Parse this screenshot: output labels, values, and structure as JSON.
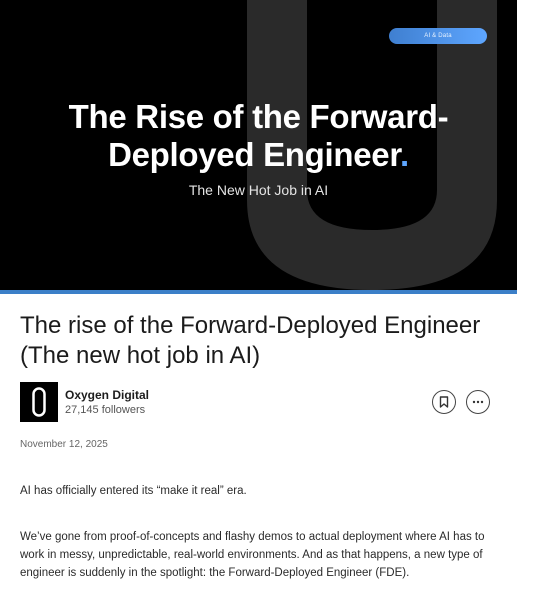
{
  "hero": {
    "badge": "AI & Data",
    "title_line1": "The Rise of the Forward-",
    "title_line2": "Deployed Engineer",
    "title_dot": ".",
    "subtitle": "The New Hot Job in AI",
    "colors": {
      "background": "#000000",
      "accent": "#5ea6ff",
      "bar": "#3b7fc8"
    }
  },
  "article": {
    "title": "The rise of the Forward-Deployed Engineer (The new hot job in AI)",
    "date": "November 12, 2025",
    "paragraphs": [
      "AI has officially entered its “make it real” era.",
      "We’ve gone from proof-of-concepts and flashy demos to actual deployment where AI has to work in messy, unpredictable, real-world environments. And as that happens, a new type of engineer is suddenly in the spotlight: the Forward-Deployed Engineer (FDE)."
    ]
  },
  "author": {
    "name": "Oxygen Digital",
    "followers": "27,145 followers",
    "avatar_icon": "oxygen-logo-icon"
  },
  "actions": {
    "save_icon": "bookmark-icon",
    "more_icon": "ellipsis-icon"
  }
}
